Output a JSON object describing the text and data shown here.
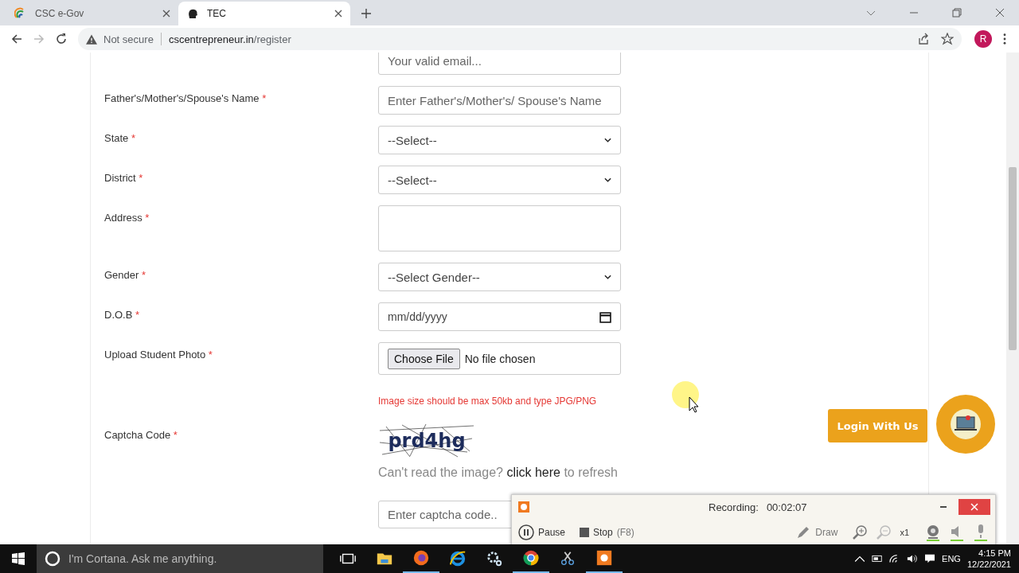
{
  "browser": {
    "tabs": [
      {
        "title": "CSC e-Gov",
        "selected": false,
        "kind": "swirl"
      },
      {
        "title": "TEC",
        "selected": true,
        "kind": "head"
      }
    ],
    "address": {
      "security": "Not secure",
      "domain": "cscentrepreneur.in",
      "path": "/register"
    },
    "profile_initial": "R"
  },
  "form": {
    "required_mark": "*",
    "fields": [
      {
        "kind": "text",
        "placeholder": "Your valid email..."
      },
      {
        "kind": "text",
        "label": "Father's/Mother's/Spouse's Name",
        "required": true,
        "placeholder": "Enter Father's/Mother's/ Spouse's Name"
      },
      {
        "kind": "select",
        "label": "State",
        "required": true,
        "value": "--Select--"
      },
      {
        "kind": "select",
        "label": "District",
        "required": true,
        "value": "--Select--"
      },
      {
        "kind": "textarea",
        "label": "Address",
        "required": true
      },
      {
        "kind": "select",
        "label": "Gender",
        "required": true,
        "value": "--Select Gender--"
      },
      {
        "kind": "date",
        "label": "D.O.B",
        "required": true,
        "placeholder": "mm/dd/yyyy"
      },
      {
        "kind": "file",
        "label": "Upload Student Photo",
        "required": true,
        "button": "Choose File",
        "status": "No file chosen"
      }
    ],
    "photo_note": "Image size should be max 50kb and type JPG/PNG",
    "captcha": {
      "label": "Captcha Code",
      "required": true,
      "image_text": "prd4hg",
      "hint_before": "Can't read the image?",
      "hint_link": "click here",
      "hint_after": "to refresh",
      "placeholder": "Enter captcha code.."
    }
  },
  "login_button": "Login With Us",
  "recorder": {
    "label": "Recording:",
    "time": "00:02:07",
    "pause": "Pause",
    "stop": "Stop",
    "stop_key": "(F8)",
    "draw": "Draw",
    "zoom": "x1"
  },
  "taskbar": {
    "search_placeholder": "I'm Cortana. Ask me anything.",
    "apps": [
      {
        "kind": "taskview",
        "running": false
      },
      {
        "kind": "folder",
        "running": false
      },
      {
        "kind": "firefox",
        "running": true
      },
      {
        "kind": "ie",
        "running": false
      },
      {
        "kind": "gears",
        "running": false
      },
      {
        "kind": "chrome",
        "running": true
      },
      {
        "kind": "scissors",
        "running": false
      },
      {
        "kind": "recorder",
        "running": true
      }
    ],
    "language": "ENG",
    "time": "4:15 PM",
    "date": "12/22/2021"
  }
}
